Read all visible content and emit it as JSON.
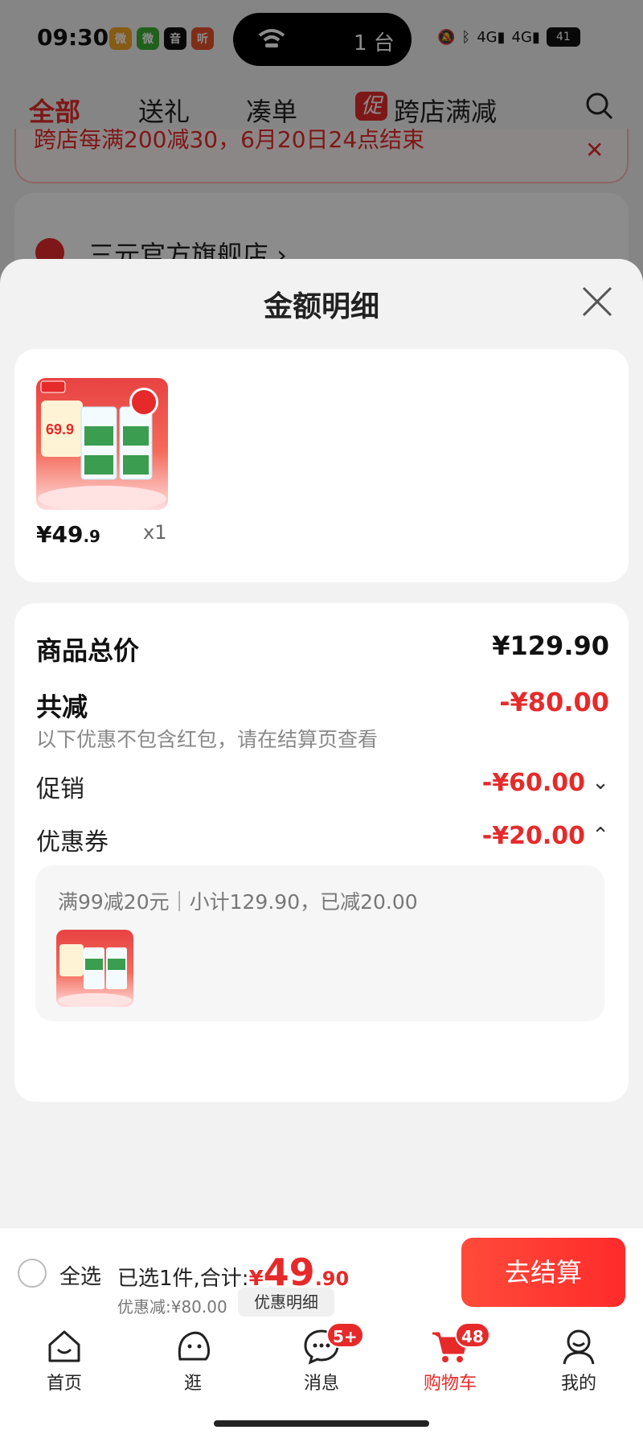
{
  "status_bar": {
    "time": "09:30",
    "island_text": "1 台",
    "battery": "41",
    "app_icons": [
      "微",
      "微",
      "音",
      "听"
    ]
  },
  "top_tabs": {
    "all": "全部",
    "gift": "送礼",
    "bundle": "凑单",
    "promo_badge": "促",
    "cross_store": "跨店满减"
  },
  "promo_banner": {
    "text": "跨店每满200减30，6月20日24点结束"
  },
  "store": {
    "name": "三元官方旗舰店 ›"
  },
  "sheet": {
    "title": "金额明细"
  },
  "product": {
    "price_main": "¥49",
    "price_decimal": ".9",
    "quantity": "x1",
    "thumb_price": "69.9"
  },
  "details": {
    "total_label": "商品总价",
    "total_value": "¥129.90",
    "discount_label": "共减",
    "discount_value": "-¥80.00",
    "hint": "以下优惠不包含红包，请在结算页查看",
    "promotion_label": "促销",
    "promotion_value": "-¥60.00",
    "coupon_label": "优惠券",
    "coupon_value": "-¥20.00",
    "coupon_detail": "满99减20元｜小计129.90，已减20.00"
  },
  "bottom_bar": {
    "select_all": "全选",
    "summary_prefix": "已选1件,合计:",
    "currency": "¥",
    "amount_int": "49",
    "amount_dec": ".90",
    "discount_note": "优惠减:¥80.00",
    "detail_button": "优惠明细",
    "checkout_button": "去结算"
  },
  "tab_bar": [
    {
      "label": "首页",
      "icon": "home-icon"
    },
    {
      "label": "逛",
      "icon": "browse-icon"
    },
    {
      "label": "消息",
      "icon": "message-icon",
      "badge": "5+"
    },
    {
      "label": "购物车",
      "icon": "cart-icon",
      "badge": "48",
      "active": true
    },
    {
      "label": "我的",
      "icon": "profile-icon"
    }
  ],
  "colors": {
    "accent": "#e62a2a",
    "sheet_bg": "#f2f2f2"
  }
}
